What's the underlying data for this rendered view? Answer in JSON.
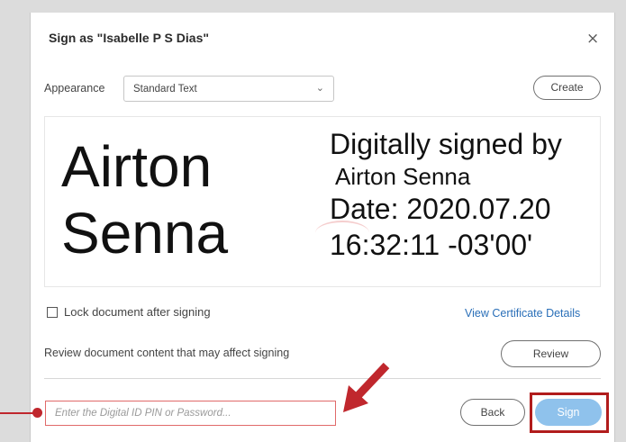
{
  "dialog": {
    "title": "Sign as \"Isabelle P S Dias\"",
    "close_symbol": "×"
  },
  "appearance": {
    "label": "Appearance",
    "selected": "Standard Text",
    "create_label": "Create"
  },
  "preview": {
    "name_line1": "Airton",
    "name_line2": "Senna",
    "details_line1": "Digitally signed by",
    "details_line2": "Airton Senna",
    "details_line3": "Date: 2020.07.20",
    "details_line4": "16:32:11 -03'00'"
  },
  "options": {
    "lock_label": "Lock document after signing",
    "lock_checked": false,
    "cert_link": "View Certificate Details",
    "review_text": "Review document content that may affect signing",
    "review_label": "Review"
  },
  "footer": {
    "pin_placeholder": "Enter the Digital ID PIN or Password...",
    "pin_value": "",
    "back_label": "Back",
    "sign_label": "Sign"
  },
  "colors": {
    "annotation_red": "#c0272d",
    "sign_button": "#8fc2ec",
    "link_blue": "#2a6fb8"
  },
  "icons": {
    "close": "close-icon",
    "dropdown": "chevron-down-icon",
    "annotation_arrow": "arrow-icon"
  }
}
